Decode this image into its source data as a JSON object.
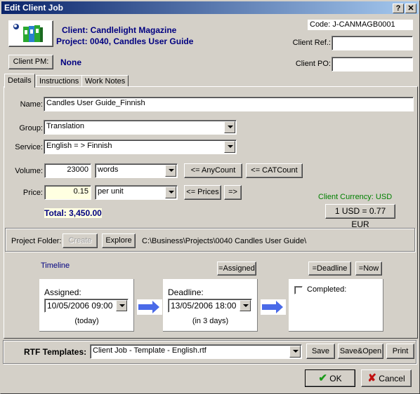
{
  "window": {
    "title": "Edit Client Job",
    "help_button": "?",
    "close_button": "✕"
  },
  "header": {
    "client": "Client: Candlelight Magazine",
    "project": "Project: 0040, Candles User Guide",
    "code": "Code: J-CANMAGB0001",
    "client_ref_label": "Client Ref.:",
    "client_ref_value": "",
    "client_po_label": "Client PO:",
    "client_po_value": "",
    "client_pm_button": "Client PM:",
    "client_pm_value": "None"
  },
  "tabs": [
    {
      "label": "Details",
      "active": true
    },
    {
      "label": "Instructions",
      "active": false
    },
    {
      "label": "Work Notes",
      "active": false
    }
  ],
  "details": {
    "name_label": "Name:",
    "name_value": "Candles User Guide_Finnish",
    "group_label": "Group:",
    "group_value": "Translation",
    "service_label": "Service:",
    "service_value": "English = > Finnish",
    "volume_label": "Volume:",
    "volume_value": "23000",
    "volume_unit": "words",
    "anycount_button": "<= AnyCount",
    "catcount_button": "<= CATCount",
    "price_label": "Price:",
    "price_value": "0.15",
    "price_unit": "per unit",
    "prices_button": "<= Prices",
    "forward_button": "=>",
    "total": "Total: 3,450.00",
    "currency_label": "Client Currency: USD",
    "exchange_button": "1 USD = 0.77 EUR",
    "project_folder_label": "Project Folder:",
    "create_button": "Create",
    "explore_button": "Explore",
    "project_folder_path": "C:\\Business\\Projects\\0040 Candles User Guide\\"
  },
  "timeline": {
    "title": "Timeline",
    "assigned_button": "=Assigned",
    "deadline_button": "=Deadline",
    "now_button": "=Now",
    "assigned_label": "Assigned:",
    "assigned_value": "10/05/2006 09:00",
    "assigned_note": "(today)",
    "deadline_label": "Deadline:",
    "deadline_value": "13/05/2006 18:00",
    "deadline_note": "(in 3 days)",
    "completed_label": "Completed:",
    "completed_checked": false
  },
  "rtf": {
    "label": "RTF Templates:",
    "value": "Client Job - Template - English.rtf",
    "save_button": "Save",
    "save_open_button": "Save&Open",
    "print_button": "Print"
  },
  "footer": {
    "ok_button": "OK",
    "cancel_button": "Cancel"
  },
  "colors": {
    "accent_text": "#000080",
    "currency_text": "#008000",
    "price_bg": "#ffffe1"
  }
}
